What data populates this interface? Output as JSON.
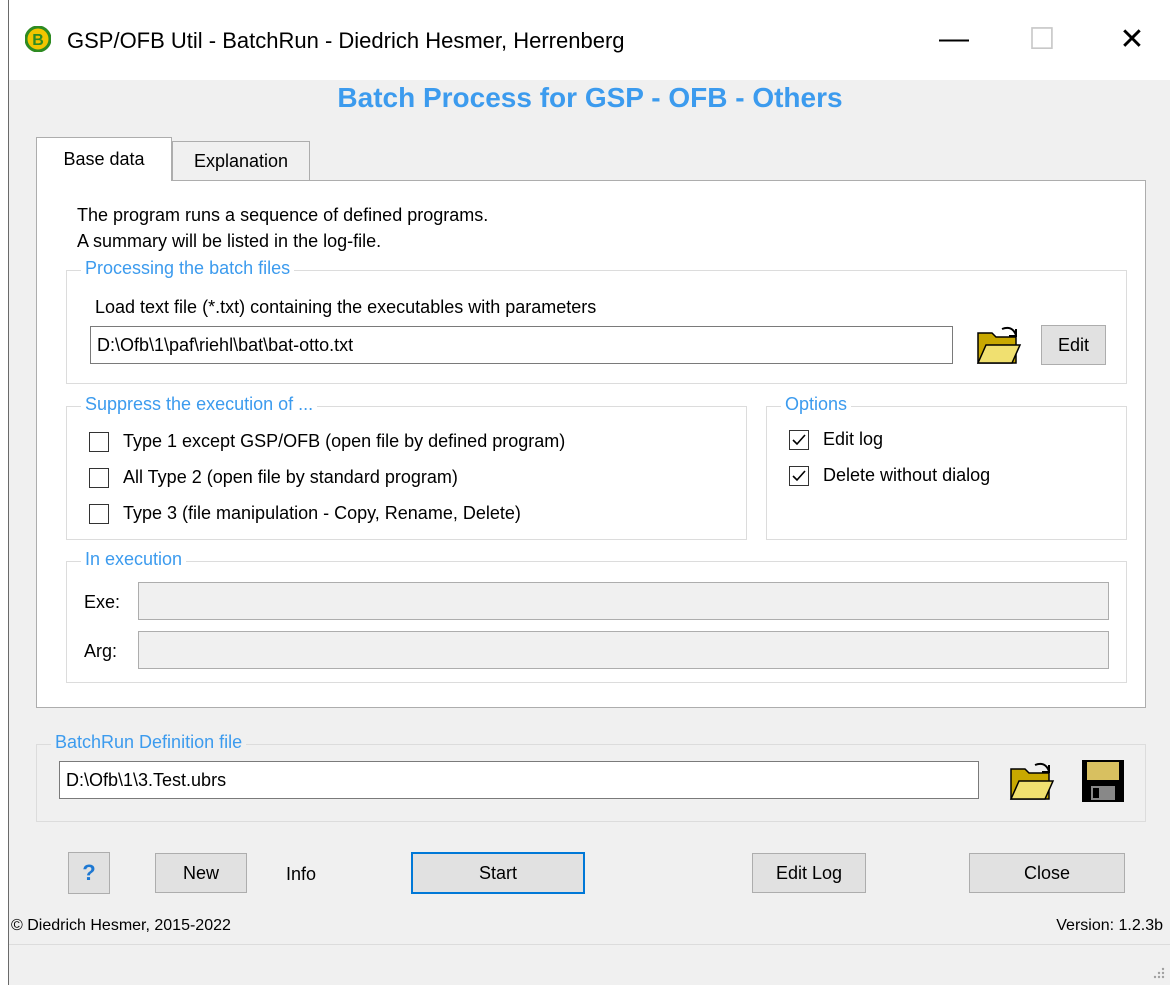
{
  "window": {
    "title": "GSP/OFB Util - BatchRun  -  Diedrich Hesmer, Herrenberg",
    "minimize_glyph": "—",
    "maximize_glyph": "☐",
    "close_glyph": "✕"
  },
  "heading": "Batch Process for GSP - OFB - Others",
  "tabs": [
    {
      "label": "Base data",
      "active": true
    },
    {
      "label": "Explanation",
      "active": false
    }
  ],
  "intro": [
    "The program runs a sequence of defined programs.",
    "A summary will be listed in the log-file."
  ],
  "processing": {
    "title": "Processing the batch files",
    "load_label": "Load text file (*.txt) containing the executables with parameters",
    "file_value": "D:\\Ofb\\1\\paf\\riehl\\bat\\bat-otto.txt",
    "open_icon": "open-folder-icon",
    "edit_label": "Edit"
  },
  "suppress": {
    "title": "Suppress the execution of ...",
    "items": [
      {
        "label": "Type 1 except GSP/OFB (open file by defined program)",
        "checked": false
      },
      {
        "label": "All Type 2 (open file by standard program)",
        "checked": false
      },
      {
        "label": "Type 3 (file manipulation - Copy, Rename, Delete)",
        "checked": false
      }
    ]
  },
  "options": {
    "title": "Options",
    "items": [
      {
        "label": "Edit log",
        "checked": true
      },
      {
        "label": "Delete without dialog",
        "checked": true
      }
    ]
  },
  "execution": {
    "title": "In execution",
    "exe_label": "Exe:",
    "exe_value": "",
    "arg_label": "Arg:",
    "arg_value": ""
  },
  "definition": {
    "title": "BatchRun Definition file",
    "file_value": "D:\\Ofb\\1\\3.Test.ubrs",
    "open_icon": "open-folder-icon",
    "save_icon": "floppy-disk-icon"
  },
  "buttons": {
    "help": "?",
    "new": "New",
    "info": "Info",
    "start": "Start",
    "edit_log": "Edit Log",
    "close": "Close"
  },
  "footer": {
    "copyright": "© Diedrich Hesmer,  2015-2022",
    "version": "Version: 1.2.3b"
  },
  "colors": {
    "accent": "#3c9bee",
    "default_button_border": "#0078d7",
    "help_icon": "#1e78d2"
  }
}
